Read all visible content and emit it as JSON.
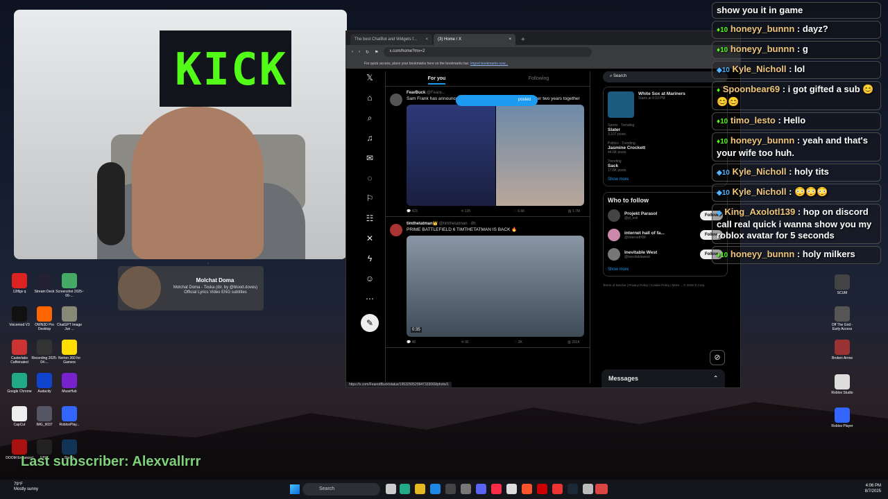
{
  "webcam": {
    "banner_text": "KICK"
  },
  "song": {
    "title": "Molchat Doma",
    "subtitle": "Molchat Doma - Toska (dir. by @blood.doves) Official Lyrics Video ENG subtitles"
  },
  "desktop_icons_left": [
    {
      "label": "12tflgv q",
      "color": "#d22"
    },
    {
      "label": "Stream Deck",
      "color": "#223"
    },
    {
      "label": "Screenshot 2025-06-...",
      "color": "#4a6"
    },
    {
      "label": "Voicemod V3",
      "color": "#111"
    },
    {
      "label": "OWN3D Pro Desktop",
      "color": "#f60"
    },
    {
      "label": "ChatGPT Image Jun ...",
      "color": "#887"
    },
    {
      "label": "Casterlabs Caffeinated",
      "color": "#c33"
    },
    {
      "label": "Recording 2025-04-...",
      "color": "#333"
    },
    {
      "label": "Norton 360 for Gamers",
      "color": "#fd0"
    },
    {
      "label": "Google Chrome",
      "color": "#2a8"
    },
    {
      "label": "Audacity",
      "color": "#14c"
    },
    {
      "label": "MuseHub",
      "color": "#72c"
    },
    {
      "label": "CapCut",
      "color": "#eee"
    },
    {
      "label": "IMG_9037",
      "color": "#556"
    },
    {
      "label": "RobloxPlay...",
      "color": "#36f"
    },
    {
      "label": "DOOM Enhanced",
      "color": "#a11"
    },
    {
      "label": "EPIC",
      "color": "#222"
    },
    {
      "label": "Steam",
      "color": "#135"
    }
  ],
  "desktop_icons_right": [
    {
      "label": "SCUM",
      "color": "#444"
    },
    {
      "label": "Off The Grid - Early Access",
      "color": "#555"
    },
    {
      "label": "Broken Arrow",
      "color": "#933"
    },
    {
      "label": "Roblox Studio",
      "color": "#ddd"
    },
    {
      "label": "Roblox Player",
      "color": "#36f"
    }
  ],
  "subscriber_text": "Last subscriber: Alexvallrrr",
  "browser": {
    "tabs": [
      {
        "label": "The best ChatBot and Widgets f...",
        "close": "×"
      },
      {
        "label": "(3) Home / X",
        "close": "×"
      }
    ],
    "new_tab": "+",
    "url": "x.com/home?mx=2",
    "bookmarks_text": "For quick access, place your bookmarks here on the bookmarks bar.",
    "bookmarks_link": "Import bookmarks now...",
    "status_url": "https://x.com/FearedBuck/status/1953250529947333069/photo/1"
  },
  "x": {
    "feed_tabs": [
      "For you",
      "Following"
    ],
    "posted_pill": "posted",
    "posts": [
      {
        "name": "FearBuck",
        "handle": "@Feare...",
        "text": "Sam Frank has announced that she and Neon have broken up after two years together",
        "replies": "423",
        "reposts": "135",
        "likes": "6.6K",
        "views": "1.7M"
      },
      {
        "name": "timthetatman👑",
        "handle": "@timthetatman · 8h",
        "text": "PRIME BATTLEFIELD 6 TIMTHETATMAN IS BACK 🔥",
        "duration": "0:35",
        "replies": "46",
        "reposts": "92",
        "likes": "3K",
        "views": "291K"
      }
    ],
    "search_placeholder": "Search",
    "event": {
      "title": "White Sox at Mariners",
      "sub": "Starts at 9:10 PM"
    },
    "trends": [
      {
        "context": "Sports · Trending",
        "name": "Slater",
        "posts": "3,107 posts"
      },
      {
        "context": "Politics · Trending",
        "name": "Jasmine Crockett",
        "posts": "44.6K posts"
      },
      {
        "context": "Trending",
        "name": "Sack",
        "posts": "17.8K posts"
      }
    ],
    "show_more": "Show more",
    "who_to_follow_title": "Who to follow",
    "follow_suggestions": [
      {
        "name": "Projekt Parasol",
        "handle": "@pl_evil"
      },
      {
        "name": "internet hall of fa...",
        "handle": "@InternetH0F"
      },
      {
        "name": "Inevitable West",
        "handle": "@Inevitablewest"
      }
    ],
    "follow_label": "Follow",
    "footer_links": "Terms of Service | Privacy Policy | Cookie Policy | More ... © 2025 X Corp.",
    "messages_label": "Messages"
  },
  "chat": [
    {
      "user": "",
      "text": "show you it in game",
      "badges": ""
    },
    {
      "user": "honeyy_bunnn",
      "text": "dayz?",
      "badges": "♦10"
    },
    {
      "user": "honeyy_bunnn",
      "text": "g",
      "badges": "♦10"
    },
    {
      "user": "Kyle_Nicholl",
      "text": "lol",
      "badges": "◆10"
    },
    {
      "user": "Spoonbear69",
      "text": "i got gifted a sub 😊😊😊",
      "badges": "♦"
    },
    {
      "user": "timo_lesto",
      "text": "Hello",
      "badges": "♦10"
    },
    {
      "user": "honeyy_bunnn",
      "text": "yeah and that's your wife too huh.",
      "badges": "♦10"
    },
    {
      "user": "Kyle_Nicholl",
      "text": "holy tits",
      "badges": "◆10"
    },
    {
      "user": "Kyle_Nicholl",
      "text": "😳😳😳",
      "badges": "◆10"
    },
    {
      "user": "King_Axolotl139",
      "text": "hop on discord call real quick i wanna show you my roblox avatar for 5 seconds",
      "badges": "◆"
    },
    {
      "user": "honeyy_bunnn",
      "text": "holy milkers",
      "badges": "♦10"
    }
  ],
  "taskbar": {
    "weather_temp": "79°F",
    "weather_desc": "Mostly sunny",
    "search_label": "Search",
    "time": "4:06 PM",
    "date": "8/7/2025"
  },
  "colors": {
    "x_blue": "#1d9bf0",
    "kick_green": "#53fc18",
    "chat_user": "#f0c77a"
  }
}
